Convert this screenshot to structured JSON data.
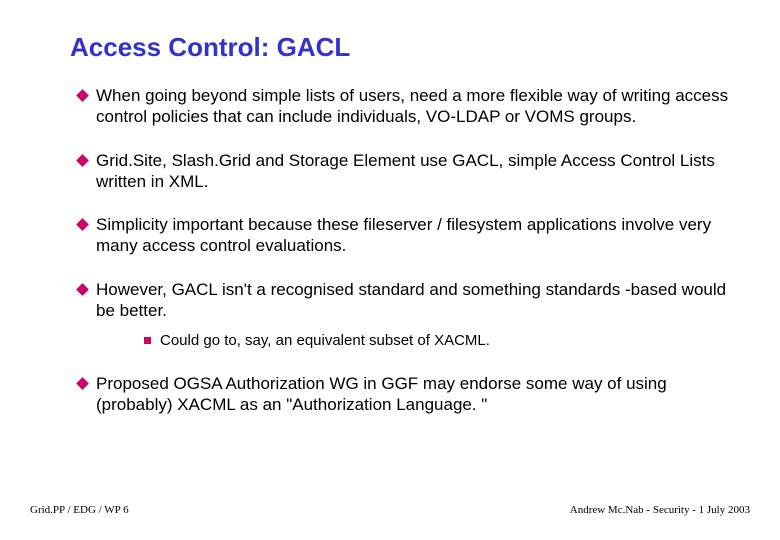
{
  "title": "Access Control: GACL",
  "bullets": [
    {
      "text": "When going beyond simple lists of users, need a more flexible way of writing access control policies that can include individuals, VO-LDAP or VOMS groups."
    },
    {
      "text": "Grid.Site, Slash.Grid and Storage Element use GACL, simple Access Control Lists written in XML."
    },
    {
      "text": "Simplicity important because these fileserver / filesystem applications involve very many access control evaluations."
    },
    {
      "text": "However, GACL isn't a recognised standard and something standards -based would be better.",
      "sub": [
        {
          "text": "Could go to, say, an equivalent subset of XACML."
        }
      ]
    },
    {
      "text": "Proposed OGSA Authorization WG in GGF may endorse some way of using (probably) XACML as an \"Authorization Language. \""
    }
  ],
  "footer": {
    "left": "Grid.PP / EDG / WP 6",
    "right": "Andrew Mc.Nab - Security - 1 July 2003"
  }
}
